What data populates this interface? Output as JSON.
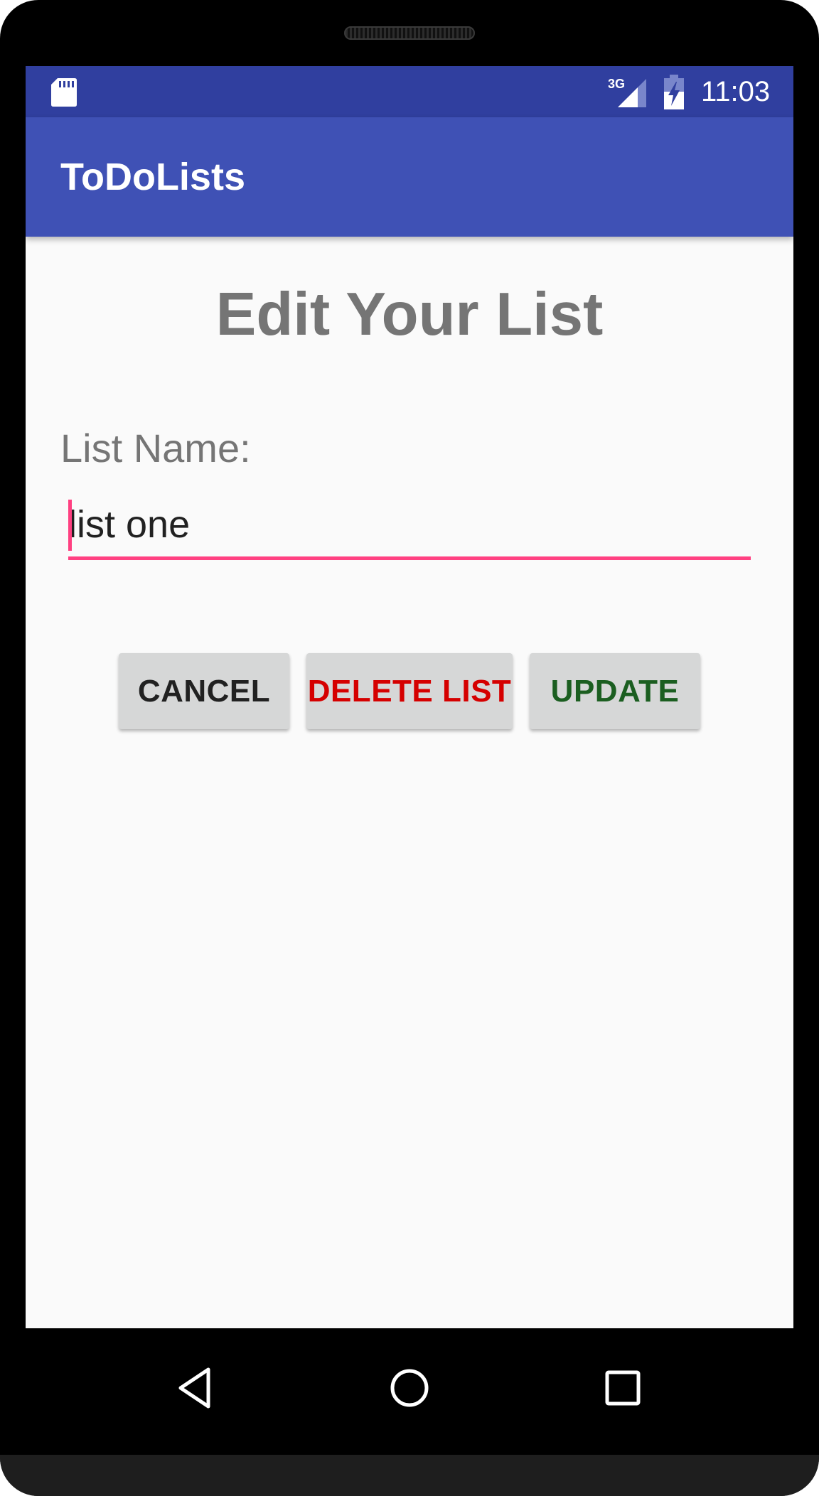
{
  "status_bar": {
    "time": "11:03",
    "network_label": "3G",
    "icons": [
      "sd-card-icon",
      "signal-icon",
      "battery-charging-icon"
    ]
  },
  "app_bar": {
    "title": "ToDoLists"
  },
  "main": {
    "page_title": "Edit Your List",
    "field_label": "List Name:",
    "list_name_value": "list one"
  },
  "buttons": {
    "cancel_label": "CANCEL",
    "delete_label": "DELETE LIST",
    "update_label": "UPDATE"
  },
  "nav_bar": {
    "icons": [
      "back-icon",
      "home-icon",
      "recents-icon"
    ]
  },
  "colors": {
    "status_bar": "#303f9f",
    "app_bar": "#3f51b5",
    "accent": "#ff4081",
    "delete_text": "#d50000",
    "update_text": "#1b5e20"
  }
}
